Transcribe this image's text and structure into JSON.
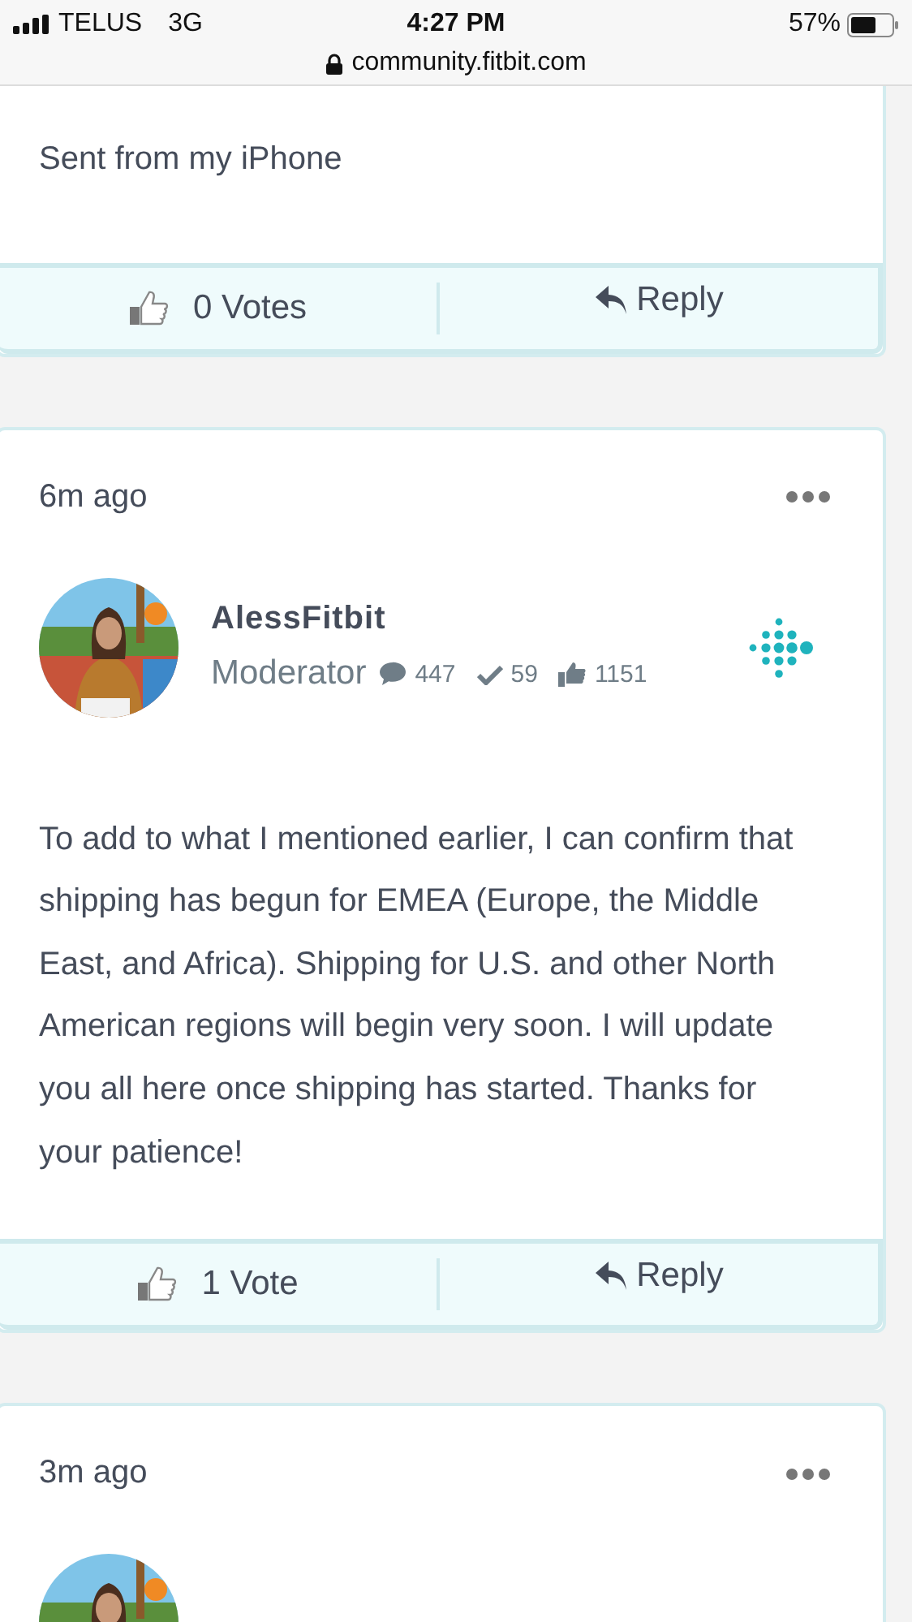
{
  "status_bar": {
    "carrier": "TELUS",
    "network": "3G",
    "time": "4:27 PM",
    "battery": "57%",
    "url": "community.fitbit.com"
  },
  "posts": [
    {
      "body": "Sent from my iPhone",
      "votes": "0 Votes",
      "reply": "Reply"
    },
    {
      "time": "6m ago",
      "author": {
        "name": "AlessFitbit",
        "rank": "Moderator",
        "messages": "447",
        "solutions": "59",
        "kudos": "1151"
      },
      "body": "To add to what I mentioned earlier, I can confirm that shipping has begun for EMEA (Europe, the Middle East, and Africa). Shipping for U.S. and other North American regions will begin very soon. I will update you all here once shipping has started. Thanks for your patience!",
      "votes": "1 Vote",
      "reply": "Reply"
    },
    {
      "time": "3m ago"
    }
  ]
}
